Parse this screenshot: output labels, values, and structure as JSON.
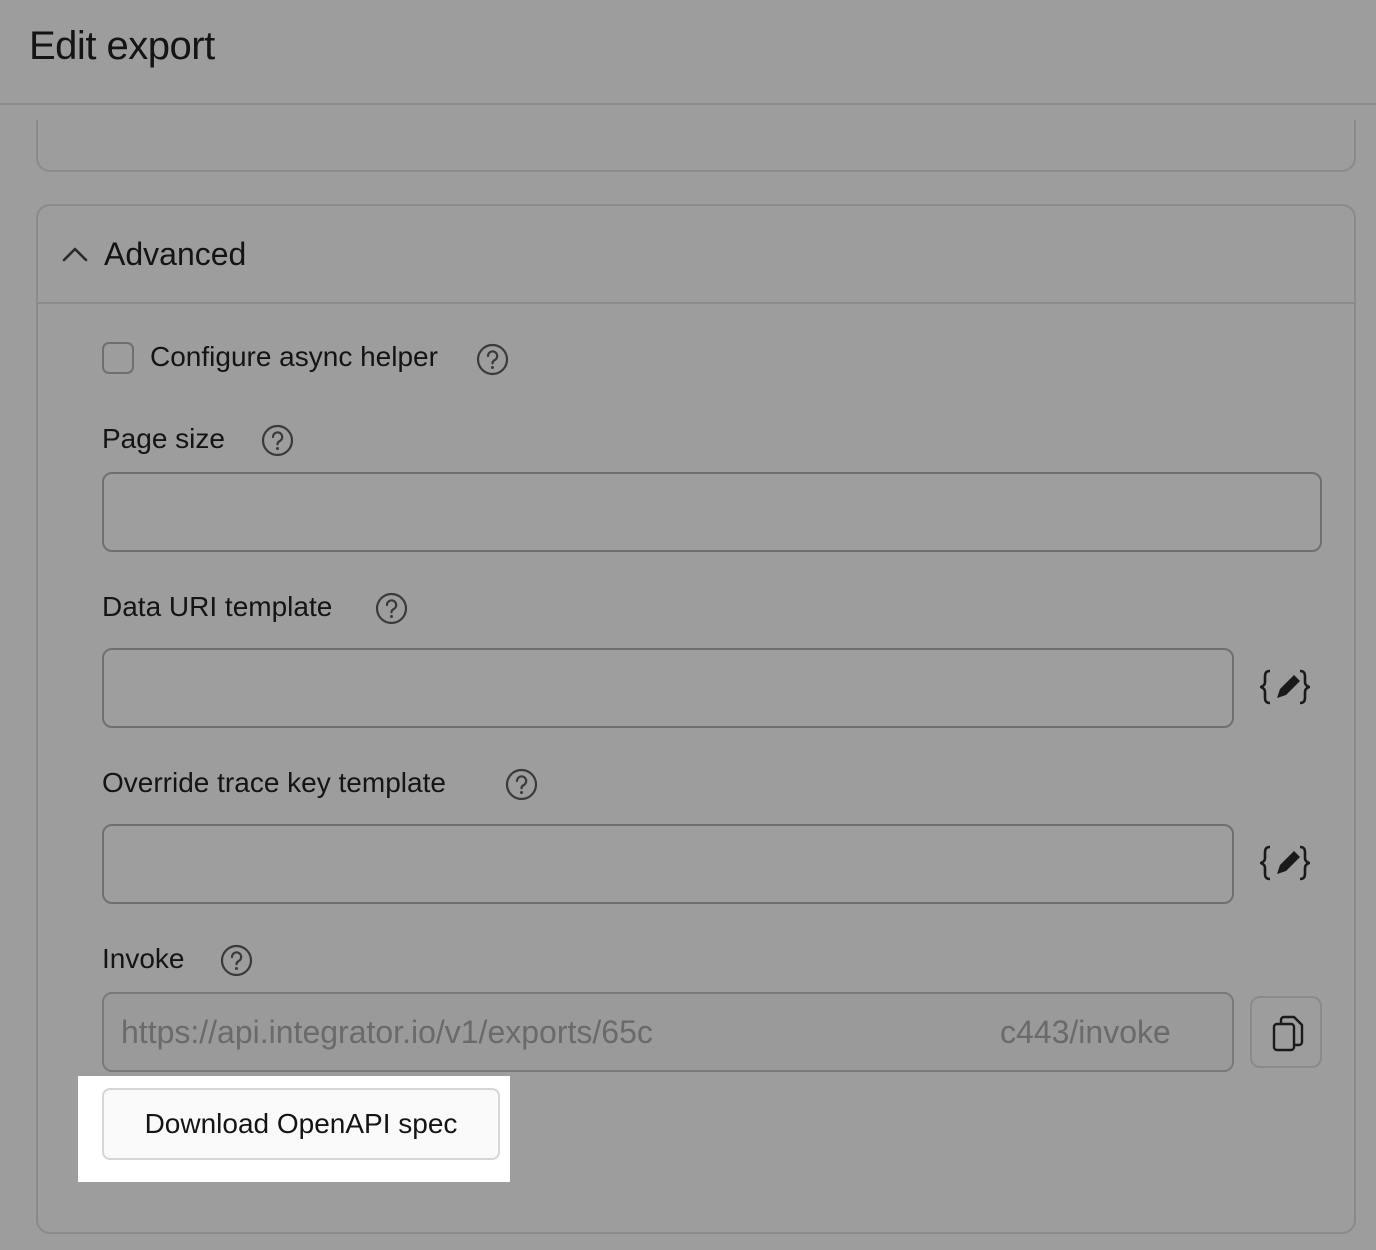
{
  "header": {
    "title": "Edit export"
  },
  "advanced": {
    "title": "Advanced",
    "async_helper_label": "Configure async helper",
    "page_size_label": "Page size",
    "page_size_value": "",
    "data_uri_label": "Data URI template",
    "data_uri_value": "",
    "trace_key_label": "Override trace key template",
    "trace_key_value": "",
    "invoke_label": "Invoke",
    "invoke_url_start": "https://api.integrator.io/v1/exports/65c",
    "invoke_url_end": "c443/invoke",
    "download_label": "Download OpenAPI spec"
  },
  "colors": {
    "overlay_bg": "#9d9d9d",
    "highlight_bg": "#ffffff",
    "button_bg": "#fafafa"
  },
  "icons": [
    "chevron-up-icon",
    "help-circle-icon",
    "template-editor-icon",
    "copy-icon"
  ]
}
